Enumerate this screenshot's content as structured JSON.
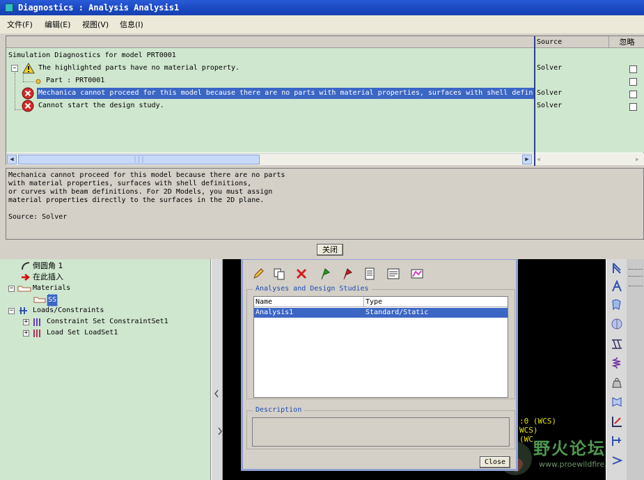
{
  "diagnostics": {
    "title": "Diagnostics : Analysis Analysis1",
    "menu": [
      "文件(F)",
      "编辑(E)",
      "视图(V)",
      "信息(I)"
    ],
    "columns": {
      "source": "Source",
      "ignore": "忽略"
    },
    "rows": [
      {
        "text": "Simulation Diagnostics for model PRT0001",
        "source": "",
        "level": 0,
        "icon": "none",
        "selected": false
      },
      {
        "text": "The highlighted parts have no material property.",
        "source": "Solver",
        "level": 1,
        "icon": "warning-icon",
        "selected": false
      },
      {
        "text": "Part : PRT0001",
        "source": "",
        "level": 2,
        "icon": "part-icon",
        "selected": false
      },
      {
        "text": "Mechanica cannot proceed for this model because there are no parts  with material properties, surfaces with shell defin",
        "source": "Solver",
        "level": 1,
        "icon": "error-icon",
        "selected": true
      },
      {
        "text": "Cannot start the design study.",
        "source": "Solver",
        "level": 1,
        "icon": "error-icon",
        "selected": false
      }
    ],
    "detail": "Mechanica cannot proceed for this model because there are no parts\nwith material properties, surfaces with shell definitions,\nor curves with beam definitions. For 2D Models, you must assign\nmaterial properties directly to the surfaces in the 2D plane.\n\nSource: Solver",
    "close_label": "关闭"
  },
  "tree": {
    "items": [
      {
        "label": "倒圆角 1",
        "indent": 1,
        "icon": "round-icon"
      },
      {
        "label": "在此插入",
        "indent": 1,
        "icon": "insert-arrow-icon"
      },
      {
        "label": "Materials",
        "indent": 0,
        "icon": "material-folder-icon"
      },
      {
        "label": "SS",
        "indent": 2,
        "icon": "material-icon",
        "selected": true
      },
      {
        "label": "Loads/Constraints",
        "indent": 0,
        "icon": "loads-icon"
      },
      {
        "label": "Constraint Set ConstraintSet1",
        "indent": 1,
        "icon": "constraint-icon"
      },
      {
        "label": "Load Set LoadSet1",
        "indent": 1,
        "icon": "load-icon"
      }
    ]
  },
  "analyses": {
    "group_title": "Analyses and Design Studies",
    "columns": {
      "name": "Name",
      "type": "Type"
    },
    "rows": [
      {
        "name": "Analysis1",
        "type": "Standard/Static"
      }
    ],
    "description_title": "Description",
    "close_label": "Close"
  },
  "graphics": {
    "csys_lines": [
      ":0 (WCS)",
      "WCS)",
      "(WC"
    ]
  },
  "watermark": {
    "name": "野火论坛",
    "url": "www.proewildfire.cn"
  },
  "colors": {
    "titlebar": "#2a5bd7",
    "selection": "#3b66c4",
    "tree_bg": "#cfe6cf",
    "group_title": "#1e4ab0",
    "error": "#d42a2a",
    "warning": "#f5d020"
  }
}
